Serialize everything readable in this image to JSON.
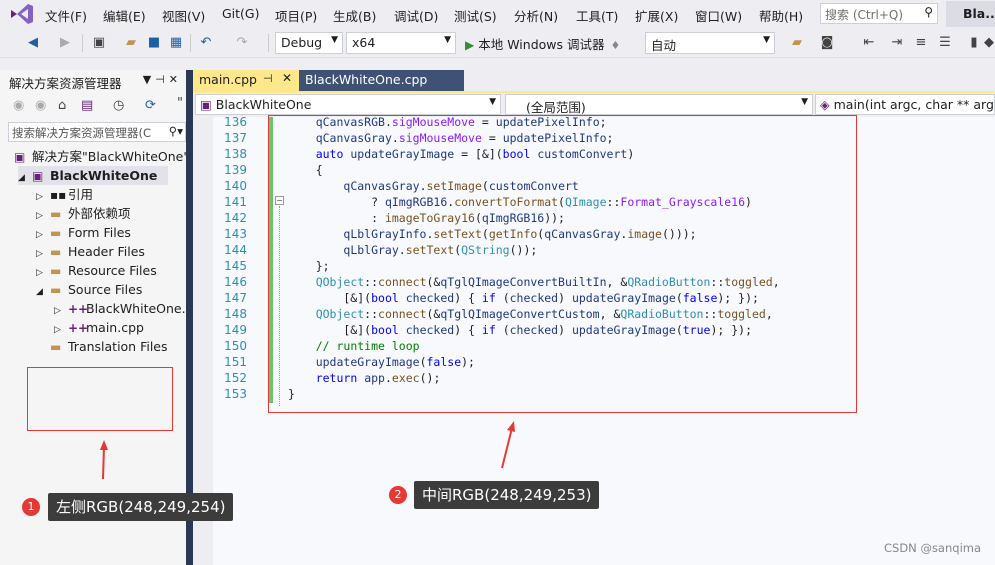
{
  "menubar": {
    "items": [
      "文件(F)",
      "编辑(E)",
      "视图(V)",
      "Git(G)",
      "项目(P)",
      "生成(B)",
      "调试(D)",
      "测试(S)",
      "分析(N)",
      "工具(T)",
      "扩展(X)",
      "窗口(W)",
      "帮助(H)"
    ],
    "search_placeholder": "搜索 (Ctrl+Q)",
    "title": "Bla..."
  },
  "toolbar": {
    "configuration": "Debug",
    "platform": "x64",
    "run_label": "本地 Windows 调试器",
    "auto_label": "自动"
  },
  "solution_explorer": {
    "title": "解决方案资源管理器",
    "search_placeholder": "搜索解决方案资源管理器(C",
    "tree": [
      {
        "label": "解决方案\"BlackWhiteOne\"",
        "icon": "solution-icon"
      },
      {
        "label": "BlackWhiteOne",
        "icon": "project-icon",
        "selected": true
      },
      {
        "label": "引用",
        "icon": "references-icon"
      },
      {
        "label": "外部依赖项",
        "icon": "external-deps-icon"
      },
      {
        "label": "Form Files",
        "icon": "folder-icon"
      },
      {
        "label": "Header Files",
        "icon": "folder-icon"
      },
      {
        "label": "Resource Files",
        "icon": "folder-icon"
      },
      {
        "label": "Source Files",
        "icon": "folder-icon"
      },
      {
        "label": "BlackWhiteOne.",
        "icon": "cpp-file-icon"
      },
      {
        "label": "main.cpp",
        "icon": "cpp-file-icon"
      },
      {
        "label": "Translation Files",
        "icon": "folder-icon"
      }
    ]
  },
  "editor": {
    "tabs": [
      "main.cpp",
      "BlackWhiteOne.cpp"
    ],
    "nav": {
      "project": "BlackWhiteOne",
      "scope": "(全局范围)",
      "function": "main(int argc, char ** argv)"
    },
    "line_numbers": [
      "136",
      "137",
      "138",
      "139",
      "140",
      "141",
      "142",
      "143",
      "144",
      "145",
      "146",
      "147",
      "148",
      "149",
      "150",
      "151",
      "152",
      "153"
    ]
  },
  "annotations": [
    {
      "number": "1",
      "text": "左侧RGB(248,249,254)"
    },
    {
      "number": "2",
      "text": "中间RGB(248,249,253)"
    }
  ],
  "watermark": "CSDN @sanqima",
  "colors": {
    "accent_tab": "#ffe88b",
    "divider": "#293955",
    "annotation_red": "#e53935",
    "change_bar": "#6bc36b"
  }
}
